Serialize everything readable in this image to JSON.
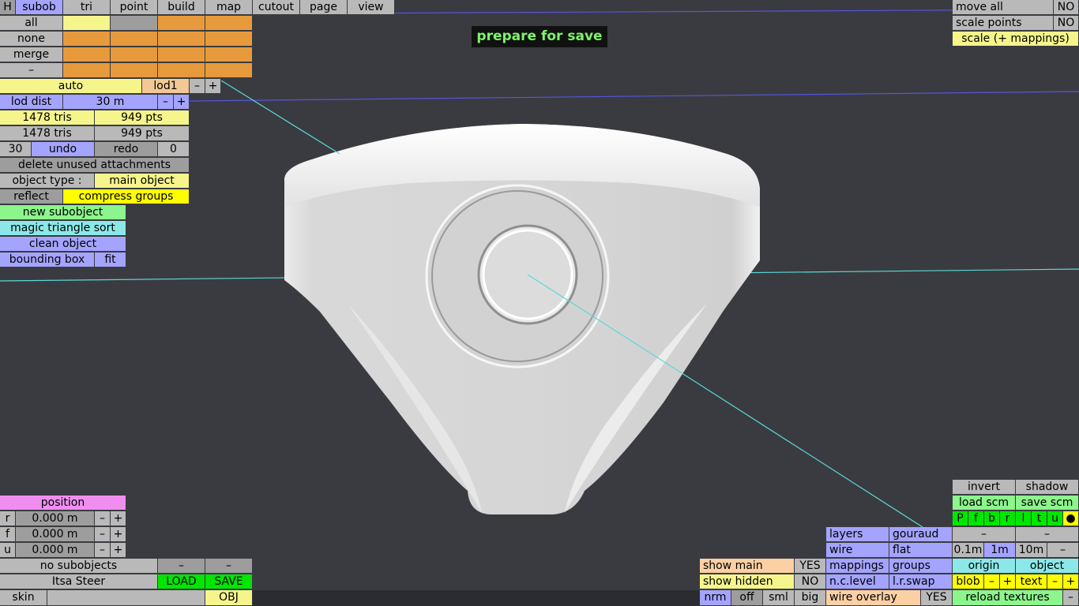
{
  "banner": "prepare for save",
  "top_tabs": [
    "H",
    "subob",
    "tri",
    "point",
    "build",
    "map",
    "cutout",
    "page",
    "view"
  ],
  "subob_rows": [
    "all",
    "none",
    "merge",
    "–"
  ],
  "lod": {
    "auto": "auto",
    "lod1": "lod1",
    "minus": "–",
    "plus": "+",
    "dist_label": "lod dist",
    "dist_value": "30 m"
  },
  "counts": {
    "tris1": "1478 tris",
    "pts1": "949 pts",
    "tris2": "1478 tris",
    "pts2": "949 pts"
  },
  "undo_row": {
    "count": "30",
    "undo": "undo",
    "redo": "redo",
    "redo_count": "0"
  },
  "left_buttons": {
    "delete_unused": "delete unused attachments",
    "object_type_label": "object type :",
    "object_type_value": "main object",
    "reflect": "reflect",
    "compress_groups": "compress groups",
    "new_subobject": "new subobject",
    "magic_triangle_sort": "magic triangle sort",
    "clean_object": "clean object",
    "bounding_box": "bounding box",
    "fit": "fit"
  },
  "top_right": [
    {
      "label": "move all",
      "value": "NO"
    },
    {
      "label": "scale points",
      "value": "NO"
    }
  ],
  "scale_mappings": "scale (+ mappings)",
  "position": {
    "title": "position",
    "rows": [
      {
        "axis": "r",
        "value": "0.000 m"
      },
      {
        "axis": "f",
        "value": "0.000 m"
      },
      {
        "axis": "u",
        "value": "0.000 m"
      }
    ],
    "minus": "–",
    "plus": "+"
  },
  "bottom_left": {
    "no_subobjects": "no subobjects",
    "dash": "–",
    "file_name": "Itsa Steer",
    "load": "LOAD",
    "save": "SAVE",
    "skin": "skin",
    "obj": "OBJ"
  },
  "bottom_center": {
    "show_main": "show main",
    "show_main_val": "YES",
    "show_hidden": "show hidden",
    "show_hidden_val": "NO",
    "nrm": "nrm",
    "off": "off",
    "sml": "sml",
    "big": "big"
  },
  "layers_panel": {
    "layers": "layers",
    "gouraud": "gouraud",
    "wire": "wire",
    "flat": "flat",
    "mappings": "mappings",
    "groups": "groups",
    "nc_level": "n.c.level",
    "lr_swap": "l.r.swap",
    "wire_overlay": "wire overlay",
    "wire_overlay_val": "YES"
  },
  "bottom_right": {
    "invert": "invert",
    "shadow": "shadow",
    "load_scm": "load scm",
    "save_scm": "save scm",
    "view_letters": [
      "P",
      "f",
      "b",
      "r",
      "l",
      "t",
      "u",
      "●"
    ],
    "dash": "–",
    "dist": [
      "0.1m",
      "1m",
      "10m",
      "–"
    ],
    "origin": "origin",
    "object": "object",
    "blob": "blob",
    "text": "text",
    "minus": "–",
    "plus": "+",
    "reload_textures": "reload textures"
  }
}
